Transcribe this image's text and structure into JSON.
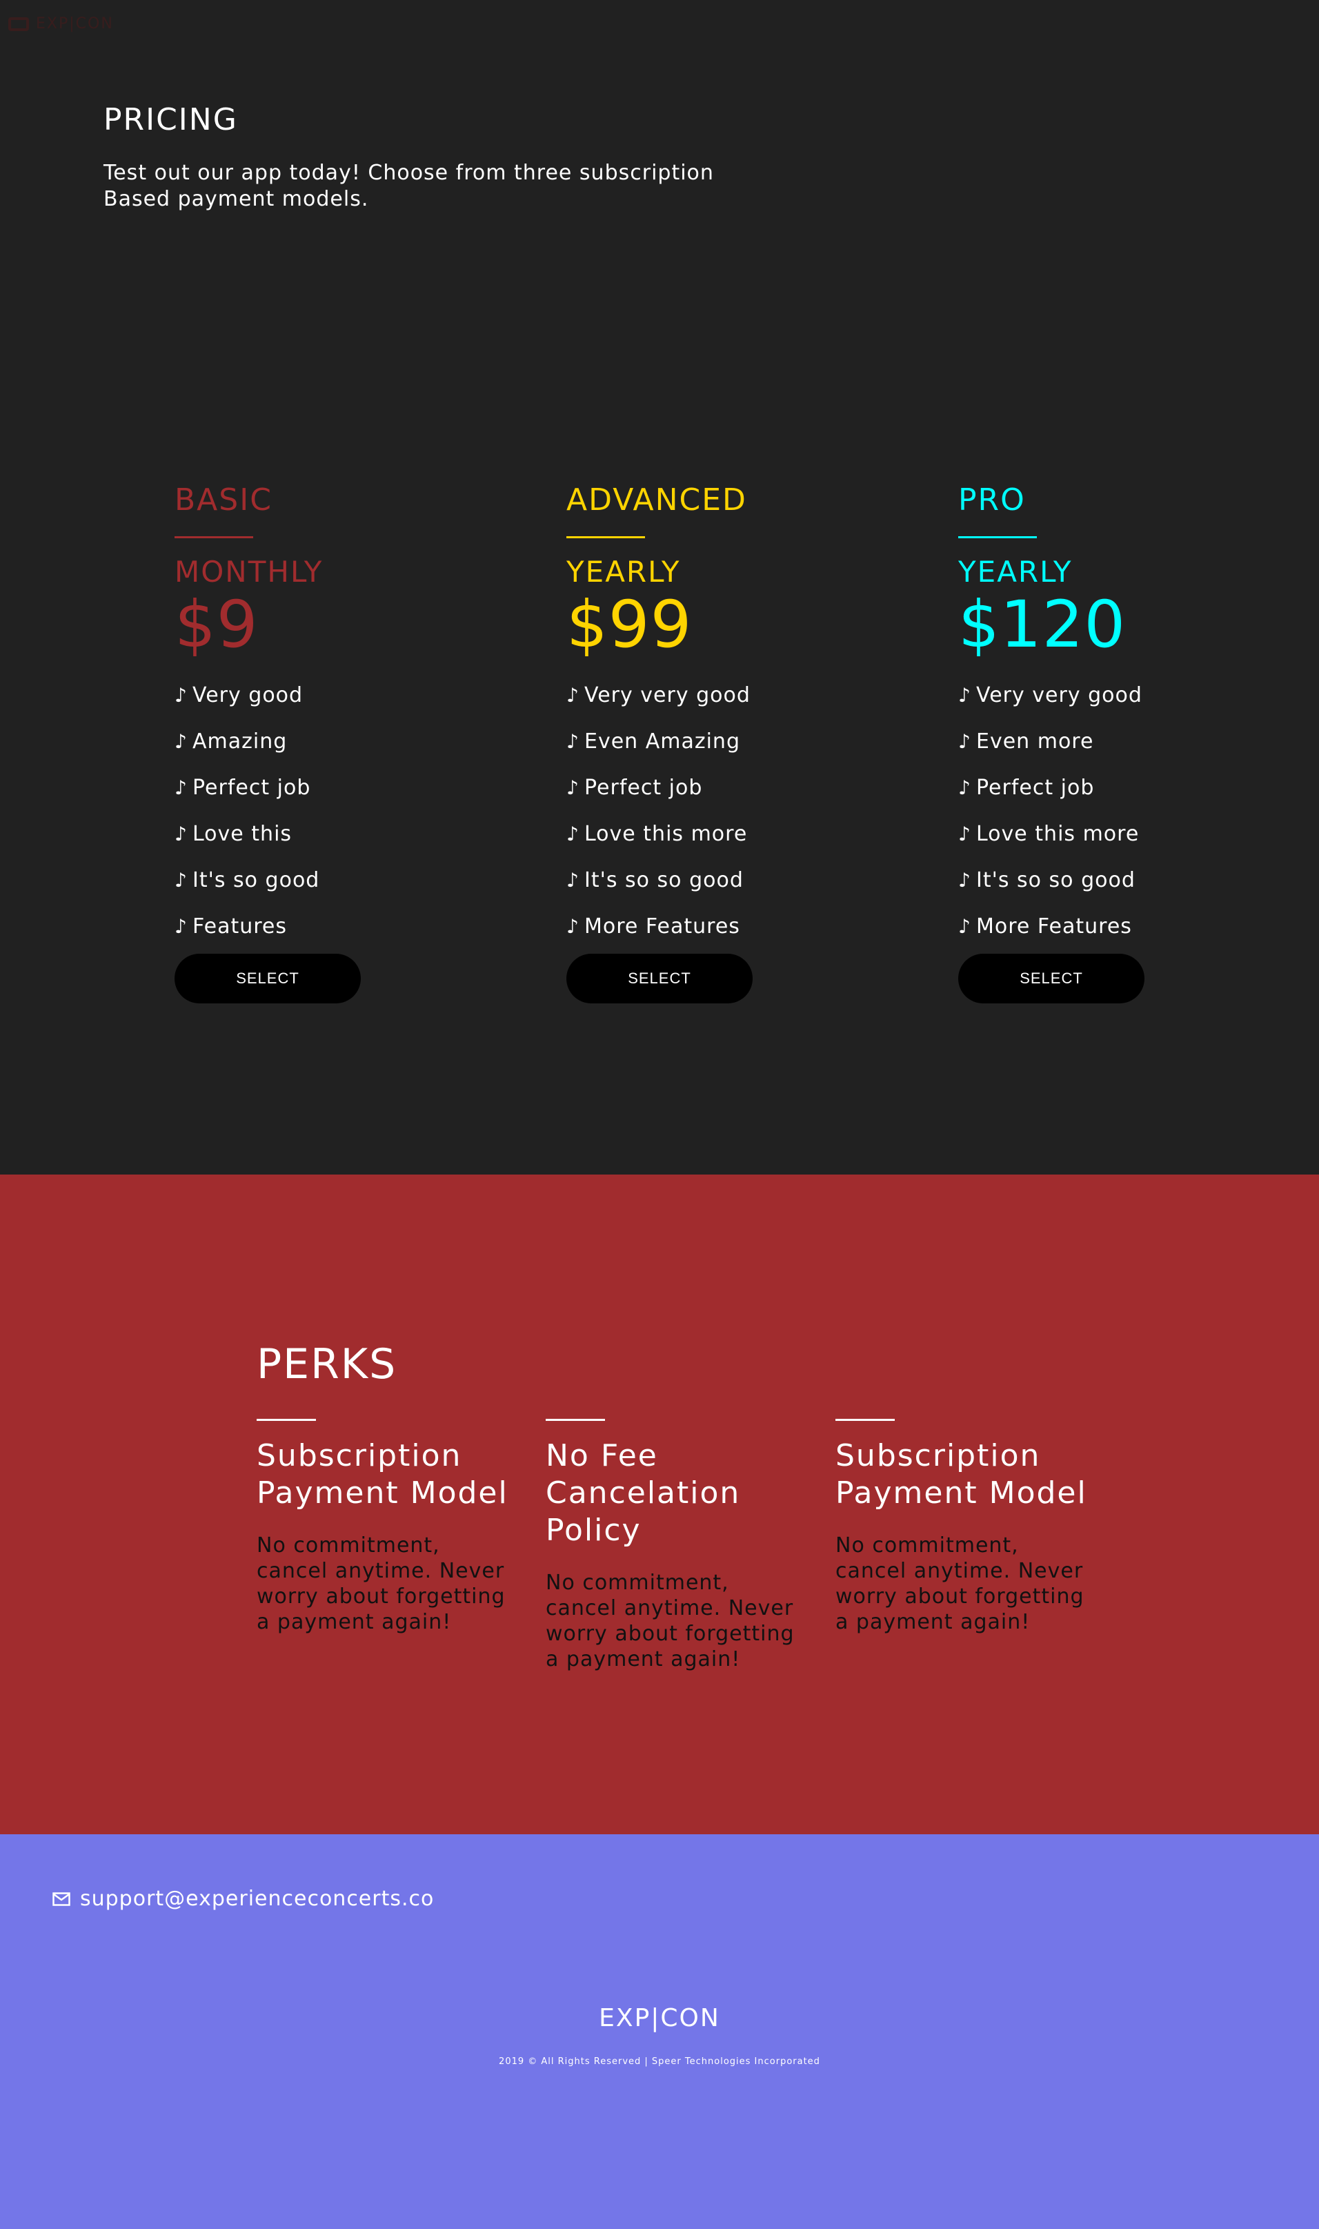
{
  "nav": {
    "logo_text": "EXP|CON"
  },
  "pricing": {
    "title": "PRICING",
    "description": "Test out our app today! Choose from three subscription Based payment models.",
    "plans": [
      {
        "name": "BASIC",
        "period": "MONTHLY",
        "price": "$9",
        "color": "#a12c2e",
        "features": [
          "Very good",
          "Amazing",
          "Perfect job",
          "Love this",
          "It's so good",
          "Features"
        ],
        "button": "SELECT"
      },
      {
        "name": "ADVANCED",
        "period": "YEARLY",
        "price": "$99",
        "color": "#ffd400",
        "features": [
          "Very very good",
          "Even Amazing",
          "Perfect job",
          "Love this more",
          "It's so so good",
          "More Features"
        ],
        "button": "SELECT"
      },
      {
        "name": "PRO",
        "period": "YEARLY",
        "price": "$120",
        "color": "#00ffff",
        "features": [
          "Very very good",
          "Even more",
          "Perfect job",
          "Love this more",
          "It's so so good",
          "More Features"
        ],
        "button": "SELECT"
      }
    ]
  },
  "perks": {
    "title": "PERKS",
    "items": [
      {
        "title": "Subscription Payment Model",
        "text": "No commitment, cancel anytime. Never worry about forgetting a payment again!"
      },
      {
        "title": "No Fee Cancelation Policy",
        "text": "No commitment, cancel anytime. Never worry about forgetting a payment again!"
      },
      {
        "title": "Subscription Payment Model",
        "text": "No commitment, cancel anytime. Never worry about forgetting a payment again!"
      }
    ]
  },
  "footer": {
    "email": "support@experienceconcerts.co",
    "brand": "EXP|CON",
    "copyright": "2019 © All Rights Reserved | Speer Technologies Incorporated",
    "background": "#7476e8"
  }
}
